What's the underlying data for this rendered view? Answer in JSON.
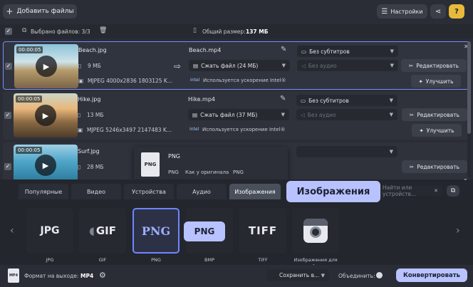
{
  "toolbar": {
    "add_files": "Добавить файлы",
    "settings": "Настройки",
    "help": "?"
  },
  "selection": {
    "selected": "Выбрано файлов: 3/3",
    "total_label": "Общий размер:",
    "total_value": "137 МБ"
  },
  "rows": [
    {
      "duration": "00:00:05",
      "src_name": "Beach.jpg",
      "size": "9 МБ",
      "info": "MJPEG 4000x2836 1803125 K...",
      "out_name": "Beach.mp4",
      "compress": "Сжать файл (24 МБ)",
      "subtitles": "Без субтитров",
      "audio": "Без аудио",
      "accel": "Используется ускорение Intel®",
      "edit": "Редактировать",
      "enhance": "Улучшить"
    },
    {
      "duration": "00:00:05",
      "src_name": "Hike.jpg",
      "size": "13 МБ",
      "info": "MJPEG 5246x3497 2147483 K...",
      "out_name": "Hike.mp4",
      "compress": "Сжать файл (37 МБ)",
      "subtitles": "Без субтитров",
      "audio": "Без аудио",
      "accel": "Используется ускорение Intel®",
      "edit": "Редактировать",
      "enhance": "Улучшить"
    },
    {
      "duration": "00:00:05",
      "src_name": "Surf.jpg",
      "size": "28 МБ",
      "edit": "Редактировать"
    }
  ],
  "preset_popup": {
    "title": "PNG",
    "icon": "PNG",
    "details": [
      "PNG",
      "Как у оригинала",
      "PNG"
    ]
  },
  "tabs": [
    "Популярные",
    "Видео",
    "Устройства",
    "Аудио",
    "Изображения"
  ],
  "search_placeholder": "Найти или устройств...",
  "tooltip_tab": "Изображения",
  "tooltip_card": "PNG",
  "formats": [
    {
      "label": "JPG",
      "caption": "JPG"
    },
    {
      "label": "GIF",
      "caption": "GIF"
    },
    {
      "label": "PNG",
      "caption": "PNG"
    },
    {
      "label": "BMP",
      "caption": "BMP"
    },
    {
      "label": "TIFF",
      "caption": "TIFF"
    },
    {
      "label": "",
      "caption": "Изображения для с..."
    }
  ],
  "footer": {
    "output_label": "Формат на выходе:",
    "output_value": "MP4",
    "save": "Сохранить в...",
    "merge": "Объединить:",
    "convert": "Конвертировать"
  },
  "colors": {
    "accent": "#7a8cff",
    "convert_bg": "#b9c3ff",
    "tooltip_bg": "#b8c2ff"
  }
}
